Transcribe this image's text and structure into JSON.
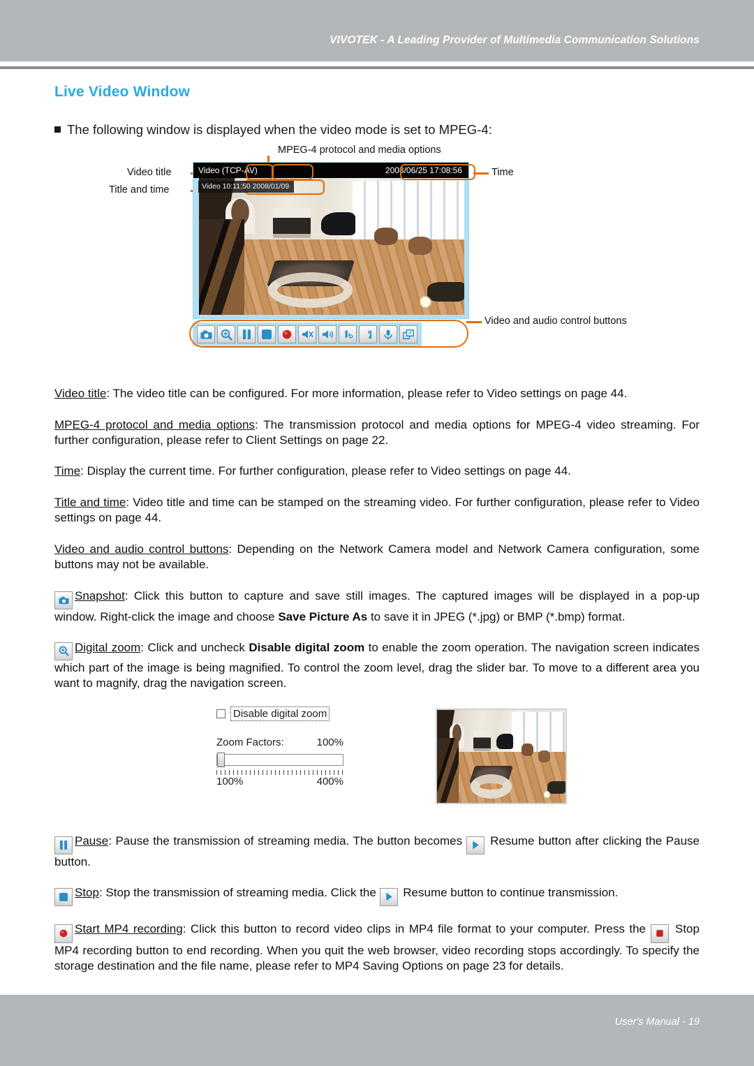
{
  "header": {
    "title": "VIVOTEK - A Leading Provider of Multimedia Communication Solutions"
  },
  "footer": {
    "title": "User's Manual - 19"
  },
  "page": {
    "section_title": "Live Video Window",
    "intro_bullet": "The following window is displayed when the video mode is set to MPEG-4:"
  },
  "figure": {
    "caption_top": "MPEG-4 protocol and media options",
    "label_video_title": "Video title",
    "label_title_and_time": "Title and time",
    "label_time": "Time",
    "label_control_buttons": "Video and audio control buttons",
    "window": {
      "title_text": "Video (TCP-AV)",
      "title_name": "Video",
      "protocol": "(TCP-AV)",
      "timestamp": "2008/06/25 17:08:56",
      "stamp_overlay": "Video 10:11:50  2008/01/09"
    },
    "control_buttons": [
      "snapshot-button",
      "digital-zoom-button",
      "pause-button",
      "stop-button",
      "start-mp4-recording-button",
      "volume-mute-button",
      "speaker-volume-button",
      "talk-button",
      "microphone-mute-button",
      "microphone-button",
      "full-screen-button"
    ]
  },
  "paragraphs": {
    "video_title": {
      "term": "Video title",
      "body": ": The video title can be configured. For more information, please refer to Video settings on page 44."
    },
    "mpeg4_protocol": {
      "term": "MPEG-4 protocol and media options",
      "body": ": The transmission protocol and media options for MPEG-4 video streaming. For further configuration, please refer to Client Settings on page 22."
    },
    "time": {
      "term": "Time",
      "body": ": Display the current time. For further configuration, please refer to Video settings on page 44."
    },
    "title_and_time": {
      "term": "Title and time",
      "body": ": Video title and time can be stamped on the streaming video. For further configuration, please refer to Video settings on page 44."
    },
    "control_buttons": {
      "term": "Video and audio control buttons",
      "body": ": Depending on the Network Camera model and Network Camera configuration, some buttons may not be available."
    },
    "snapshot": {
      "term": "Snapshot",
      "body_1": ": Click this button to capture and save still images. The captured images will be displayed in a pop-up window. Right-click the image and choose ",
      "bold": "Save Picture As",
      "body_2": " to save it in JPEG (*.jpg) or BMP (*.bmp) format."
    },
    "digital_zoom": {
      "term": "Digital zoom",
      "body_1": ": Click and uncheck ",
      "bold": "Disable digital zoom",
      "body_2": " to enable the zoom operation. The navigation screen indicates which part of the image is being magnified. To control the zoom level, drag the slider bar. To move to a different area you want to magnify, drag the navigation screen."
    },
    "pause": {
      "term": "Pause",
      "body_1": ": Pause the transmission of streaming media. The button becomes ",
      "body_2": " Resume button after clicking the Pause button."
    },
    "stop": {
      "term": "Stop",
      "body_1": ": Stop the transmission of streaming media. Click the ",
      "body_2": " Resume button to continue transmission."
    },
    "mp4_recording": {
      "term": "Start MP4 recording",
      "body_1": ": Click this button to record video clips in MP4 file format to your computer. Press the ",
      "body_2": " Stop MP4 recording button to end recording. When you quit the web browser, video recording stops accordingly. To specify the storage destination and the file name, please refer to MP4 Saving Options on page 23 for details."
    }
  },
  "digital_zoom_dialog": {
    "disable_checkbox_label": "Disable digital zoom",
    "zoom_factors_label": "Zoom Factors:",
    "zoom_factors_value": "100%",
    "range_min": "100%",
    "range_max": "400%"
  },
  "colors": {
    "header_gray": "#b4b7b9",
    "accent_blue": "#29ABE2",
    "annotation_orange": "#E36C09",
    "video_window_blue": "#b3dff2"
  }
}
